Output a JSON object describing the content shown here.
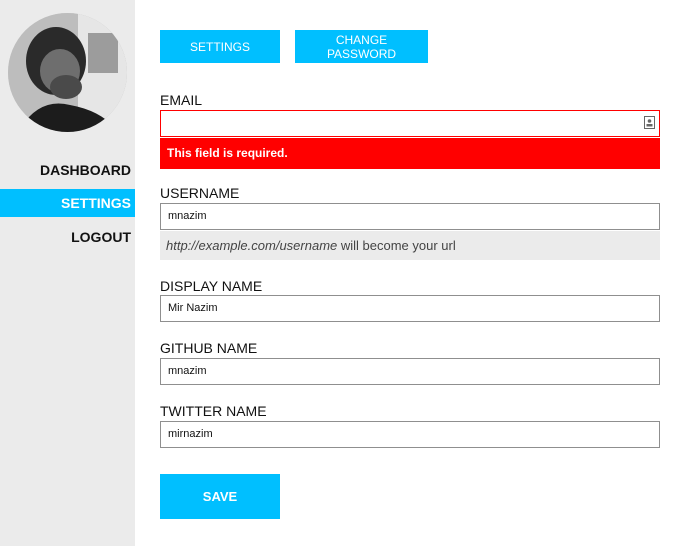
{
  "sidebar": {
    "items": [
      {
        "label": "DASHBOARD"
      },
      {
        "label": "SETTINGS",
        "active": true
      },
      {
        "label": "LOGOUT"
      }
    ]
  },
  "tabs": {
    "settings_label": "SETTINGS",
    "change_password_label": "CHANGE PASSWORD"
  },
  "form": {
    "email": {
      "label": "EMAIL",
      "value": "",
      "error": "This field is required."
    },
    "username": {
      "label": "USERNAME",
      "value": "mnazim",
      "hint_url": "http://example.com/username",
      "hint_suffix": " will become your url"
    },
    "display_name": {
      "label": "DISPLAY NAME",
      "value": "Mir Nazim"
    },
    "github_name": {
      "label": "GITHUB NAME",
      "value": "mnazim"
    },
    "twitter_name": {
      "label": "TWITTER NAME",
      "value": "mirnazim"
    },
    "save_label": "SAVE"
  },
  "colors": {
    "accent": "#00bfff",
    "error": "#ff0000",
    "sidebar_bg": "#ebebeb"
  }
}
